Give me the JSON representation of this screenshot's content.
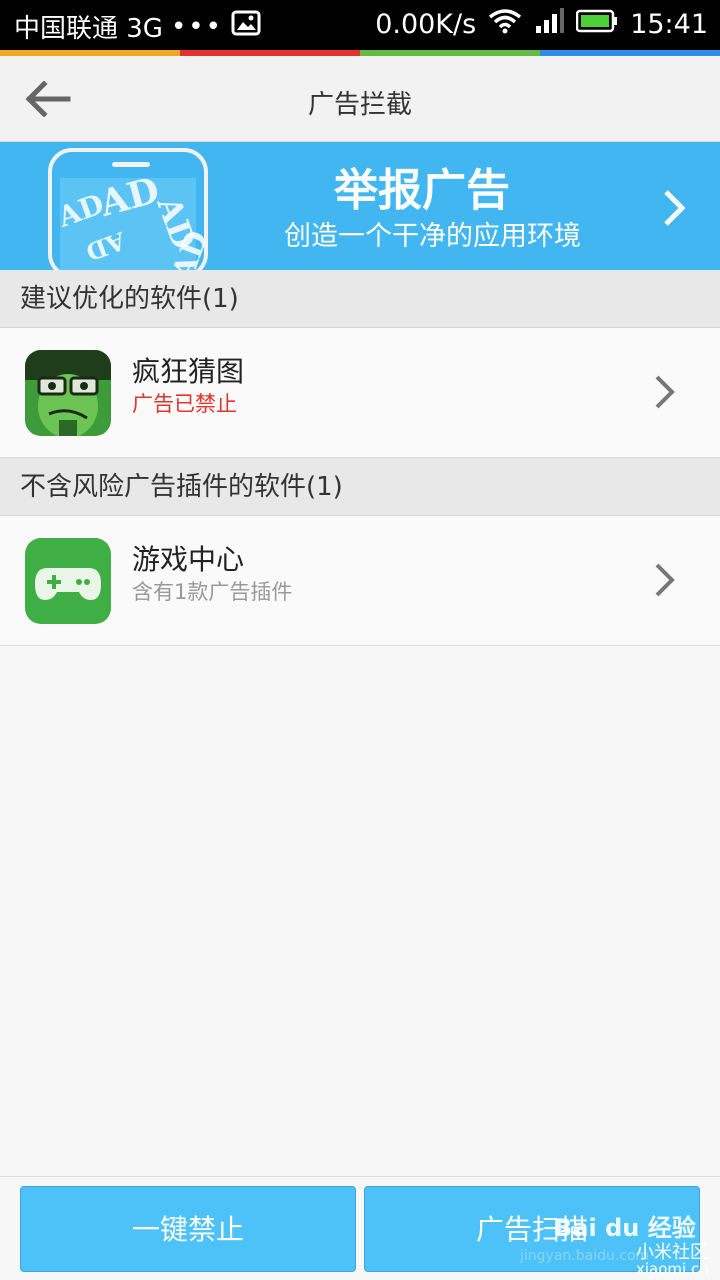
{
  "statusbar": {
    "carrier": "中国联通 3G",
    "dots": "•••",
    "net_speed": "0.00K/s",
    "time": "15:41",
    "icons": [
      "image-icon",
      "wifi-icon",
      "signal-icon",
      "battery-icon"
    ],
    "stripe_colors": [
      "#f5a623",
      "#e2342c",
      "#63bb44",
      "#2f8fe4"
    ]
  },
  "header": {
    "title": "广告拦截",
    "back_icon": "back-arrow-icon"
  },
  "banner": {
    "title": "举报广告",
    "subtitle": "创造一个干净的应用环境",
    "ad_marks": [
      "AD",
      "AD",
      "AD",
      "AD",
      "AD"
    ],
    "bg_color": "#41b6f0"
  },
  "sections": [
    {
      "header": "建议优化的软件(1)",
      "apps": [
        {
          "name": "疯狂猜图",
          "status": "广告已禁止",
          "status_color": "#e2342c",
          "icon": "crazy-guess-app-icon"
        }
      ]
    },
    {
      "header": "不含风险广告插件的软件(1)",
      "apps": [
        {
          "name": "游戏中心",
          "status": "含有1款广告插件",
          "status_color": "#999999",
          "icon": "game-center-app-icon"
        }
      ]
    }
  ],
  "bottom": {
    "block_all_label": "一键禁止",
    "scan_label": "广告扫描",
    "button_color": "#4cc2f8"
  },
  "watermark": {
    "brand": "Bai du 经验",
    "url": "jingyan.baidu.com",
    "community": "小米社区",
    "community_url": "xiaomi.cn"
  }
}
